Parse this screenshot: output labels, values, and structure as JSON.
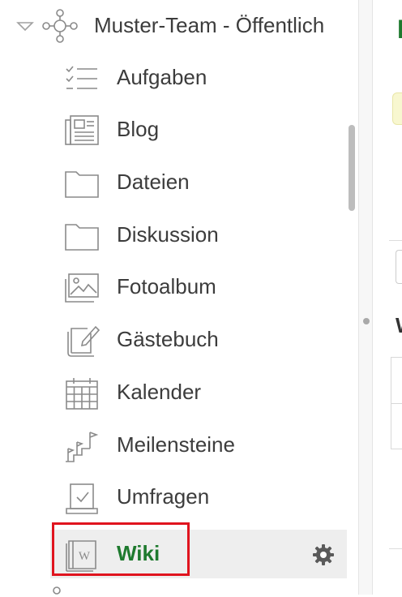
{
  "sidebar": {
    "team": {
      "label": "Muster-Team - Öffentlich",
      "icon": "network-icon"
    },
    "items": [
      {
        "label": "Aufgaben",
        "icon": "checklist-icon"
      },
      {
        "label": "Blog",
        "icon": "newspaper-icon"
      },
      {
        "label": "Dateien",
        "icon": "folder-icon"
      },
      {
        "label": "Diskussion",
        "icon": "folder-icon"
      },
      {
        "label": "Fotoalbum",
        "icon": "photo-album-icon"
      },
      {
        "label": "Gästebuch",
        "icon": "guestbook-icon"
      },
      {
        "label": "Kalender",
        "icon": "calendar-icon"
      },
      {
        "label": "Meilensteine",
        "icon": "milestones-icon"
      },
      {
        "label": "Umfragen",
        "icon": "poll-icon"
      },
      {
        "label": "Wiki",
        "icon": "wiki-book-icon",
        "active": true
      }
    ],
    "wiki_icon_letter": "W"
  },
  "main": {
    "heading_partial": "N",
    "subheading_partial": "W"
  },
  "colors": {
    "active_text": "#1e7a2e",
    "highlight_box": "#e0141e",
    "active_background": "#eeeeee"
  }
}
